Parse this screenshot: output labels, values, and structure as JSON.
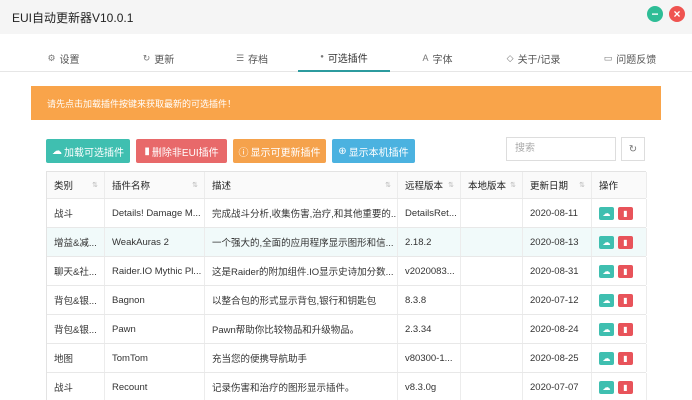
{
  "window": {
    "title": "EUI自动更新器V10.0.1"
  },
  "tabs": [
    {
      "label": "设置",
      "icon": "gear-icon",
      "glyph": "⚙"
    },
    {
      "label": "更新",
      "icon": "refresh-icon",
      "glyph": "↻"
    },
    {
      "label": "存档",
      "icon": "database-icon",
      "glyph": "☰"
    },
    {
      "label": "可选插件",
      "icon": "bulb-icon",
      "glyph": "●"
    },
    {
      "label": "字体",
      "icon": "font-icon",
      "glyph": "A"
    },
    {
      "label": "关于/记录",
      "icon": "shield-icon",
      "glyph": "◇"
    },
    {
      "label": "问题反馈",
      "icon": "comment-icon",
      "glyph": "▭"
    }
  ],
  "alert": {
    "text": "请先点击加载插件按键来获取最新的可选插件！"
  },
  "toolbar": {
    "load_label": "加载可选插件",
    "delete_label": "删除非EUI插件",
    "show_updatable_label": "显示可更新插件",
    "show_local_label": "显示本机插件",
    "search_placeholder": "搜索"
  },
  "table": {
    "headers": [
      "类别",
      "插件名称",
      "描述",
      "远程版本",
      "本地版本",
      "更新日期",
      "操作"
    ],
    "rows": [
      {
        "category": "战斗",
        "name": "Details! Damage M...",
        "desc": "完成战斗分析,收集伤害,治疗,和其他重要的...",
        "remote": "DetailsRet...",
        "local": "",
        "date": "2020-08-11"
      },
      {
        "category": "增益&减...",
        "name": "WeakAuras 2",
        "desc": "一个强大的,全面的应用程序显示图形和信...",
        "remote": "2.18.2",
        "local": "",
        "date": "2020-08-13"
      },
      {
        "category": "聊天&社...",
        "name": "Raider.IO Mythic Pl...",
        "desc": "这是Raider的附加组件.IO显示史诗加分数...",
        "remote": "v2020083...",
        "local": "",
        "date": "2020-08-31"
      },
      {
        "category": "背包&银...",
        "name": "Bagnon",
        "desc": "以整合包的形式显示背包,银行和钥匙包",
        "remote": "8.3.8",
        "local": "",
        "date": "2020-07-12"
      },
      {
        "category": "背包&银...",
        "name": "Pawn",
        "desc": "Pawn帮助你比较物品和升级物品。",
        "remote": "2.3.34",
        "local": "",
        "date": "2020-08-24"
      },
      {
        "category": "地图",
        "name": "TomTom",
        "desc": "充当您的便携导航助手",
        "remote": "v80300-1...",
        "local": "",
        "date": "2020-08-25"
      },
      {
        "category": "战斗",
        "name": "Recount",
        "desc": "记录伤害和治疗的图形显示插件。",
        "remote": "v8.3.0g",
        "local": "",
        "date": "2020-07-07"
      }
    ]
  }
}
